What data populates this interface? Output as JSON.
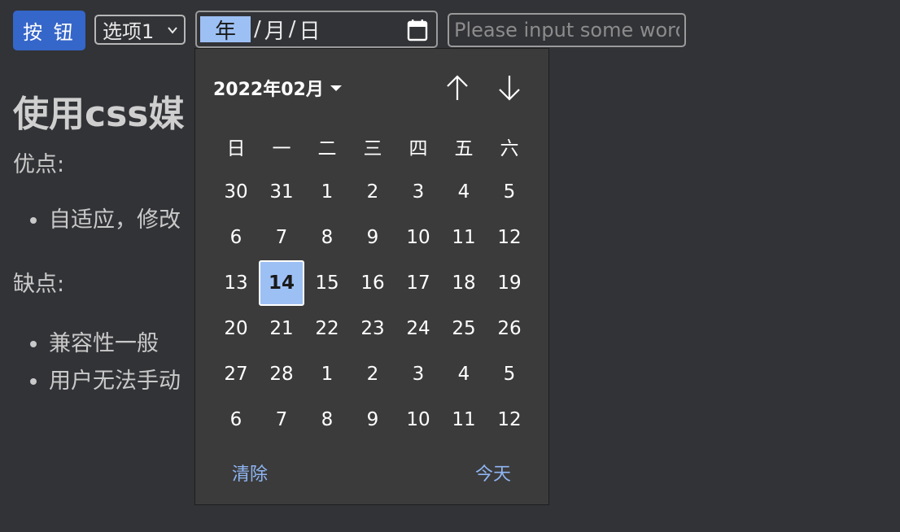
{
  "toolbar": {
    "button_label": "按 钮",
    "select_value": "选项1",
    "date_input": {
      "year_placeholder": "年",
      "month_placeholder": "月",
      "day_placeholder": "日",
      "separator": "/"
    },
    "text_placeholder": "Please input some words"
  },
  "content": {
    "title": "使用css媒",
    "pros_label": "优点:",
    "pros_items": [
      "自适应，修改"
    ],
    "cons_label": "缺点:",
    "cons_items": [
      "兼容性一般",
      "用户无法手动"
    ]
  },
  "datepicker": {
    "month_label": "2022年02月",
    "weekdays": [
      "日",
      "一",
      "二",
      "三",
      "四",
      "五",
      "六"
    ],
    "weeks": [
      [
        "30",
        "31",
        "1",
        "2",
        "3",
        "4",
        "5"
      ],
      [
        "6",
        "7",
        "8",
        "9",
        "10",
        "11",
        "12"
      ],
      [
        "13",
        "14",
        "15",
        "16",
        "17",
        "18",
        "19"
      ],
      [
        "20",
        "21",
        "22",
        "23",
        "24",
        "25",
        "26"
      ],
      [
        "27",
        "28",
        "1",
        "2",
        "3",
        "4",
        "5"
      ],
      [
        "6",
        "7",
        "8",
        "9",
        "10",
        "11",
        "12"
      ]
    ],
    "selected_day": "14",
    "clear_label": "清除",
    "today_label": "今天"
  },
  "colors": {
    "background": "#323337",
    "primary_button": "#3566c9",
    "highlight": "#9dc0f4",
    "popup_bg": "#3b3b3b",
    "link": "#8fb6f3"
  },
  "icons": {
    "calendar": "calendar-icon",
    "select_chevron": "chevron-down-icon",
    "month_caret": "caret-down-icon",
    "prev": "arrow-up-icon",
    "next": "arrow-down-icon"
  }
}
